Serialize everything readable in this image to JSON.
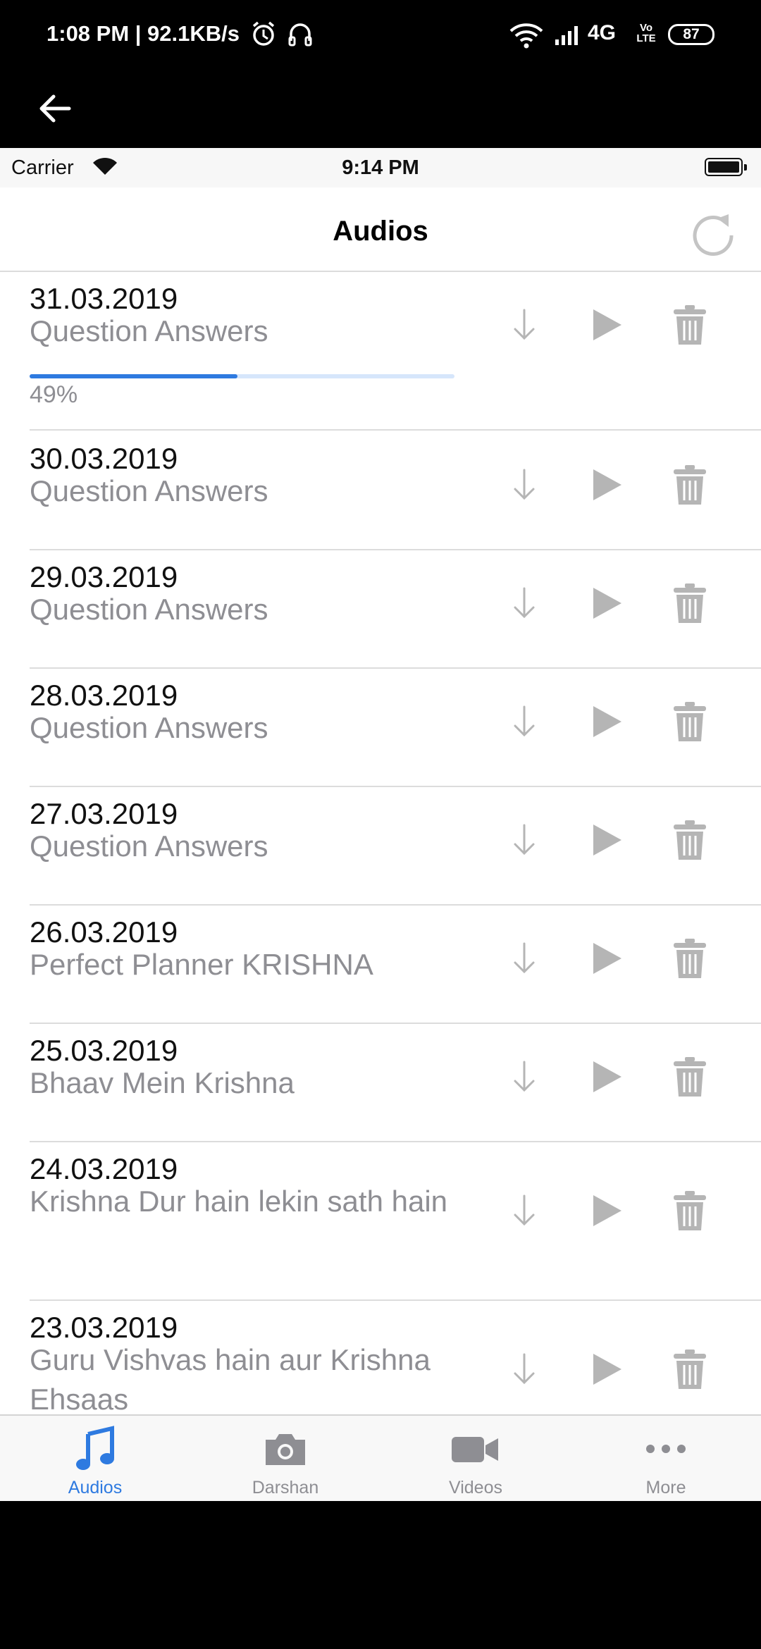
{
  "system_status": {
    "time_speed": "1:08 PM | 92.1KB/s",
    "network": "4G",
    "volte_top": "Vo",
    "volte_bottom": "LTE",
    "battery": "87"
  },
  "ios_status": {
    "carrier": "Carrier",
    "time": "9:14 PM"
  },
  "navbar": {
    "title": "Audios"
  },
  "audios": [
    {
      "date": "31.03.2019",
      "title": "Question Answers",
      "progress": 0.49,
      "progress_label": "49%"
    },
    {
      "date": "30.03.2019",
      "title": "Question Answers"
    },
    {
      "date": "29.03.2019",
      "title": "Question Answers"
    },
    {
      "date": "28.03.2019",
      "title": "Question Answers"
    },
    {
      "date": "27.03.2019",
      "title": "Question Answers"
    },
    {
      "date": "26.03.2019",
      "title": "Perfect Planner KRISHNA"
    },
    {
      "date": "25.03.2019",
      "title": "Bhaav Mein Krishna"
    },
    {
      "date": "24.03.2019",
      "title": "Krishna Dur hain lekin sath hain"
    },
    {
      "date": "23.03.2019",
      "title": "Guru Vishvas hain aur Krishna Ehsaas"
    }
  ],
  "row_actions": [
    "download-icon",
    "play-icon",
    "trash-icon"
  ],
  "tabbar": {
    "tabs": [
      {
        "label": "Audios",
        "icon": "music-note-icon",
        "active": true
      },
      {
        "label": "Darshan",
        "icon": "camera-icon",
        "active": false
      },
      {
        "label": "Videos",
        "icon": "video-camera-icon",
        "active": false
      },
      {
        "label": "More",
        "icon": "more-dots-icon",
        "active": false
      }
    ]
  },
  "colors": {
    "accent": "#2e7ae0",
    "icon_gray": "#b5b5b5",
    "secondary_text": "#8e8e93"
  }
}
